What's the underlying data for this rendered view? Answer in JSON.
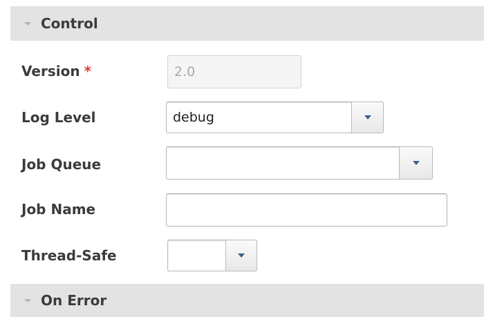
{
  "sections": {
    "control": {
      "title": "Control"
    },
    "on_error": {
      "title": "On Error"
    }
  },
  "fields": {
    "version": {
      "label": "Version",
      "required_mark": "*",
      "value": "2.0"
    },
    "log_level": {
      "label": "Log Level",
      "value": "debug"
    },
    "job_queue": {
      "label": "Job Queue",
      "value": ""
    },
    "job_name": {
      "label": "Job Name",
      "value": ""
    },
    "thread_safe": {
      "label": "Thread-Safe",
      "value": ""
    }
  },
  "icons": {
    "collapse": "triangle-down-icon",
    "dropdown": "dropdown-arrow-icon"
  },
  "colors": {
    "section_bg": "#e3e3e3",
    "required": "#e03b32",
    "dropdown_arrow": "#3a5e87"
  }
}
